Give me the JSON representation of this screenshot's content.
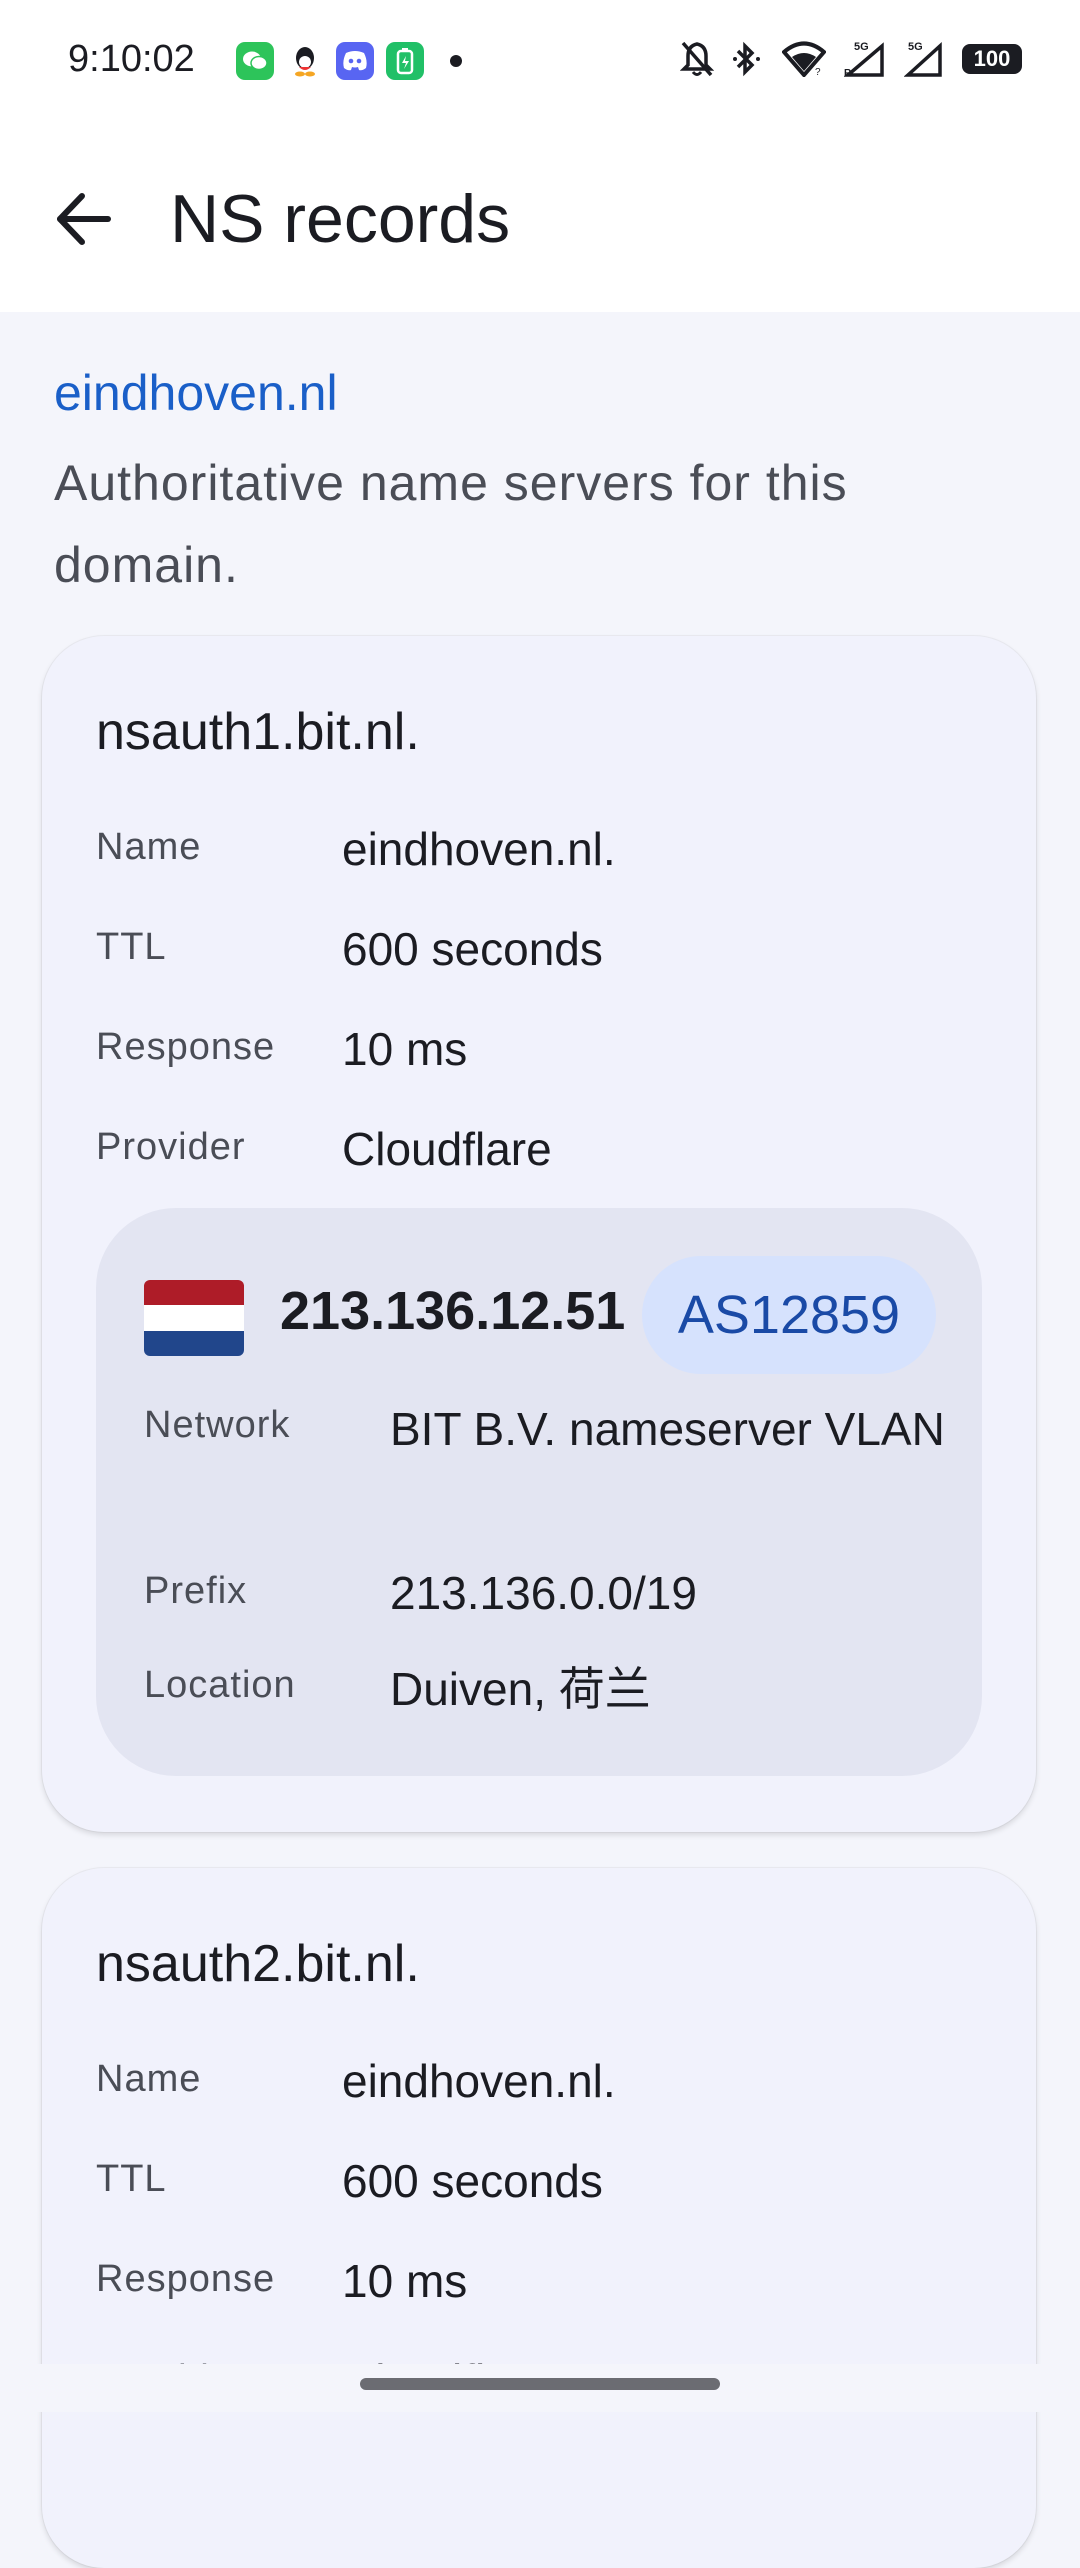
{
  "status_bar": {
    "time": "9:10:02",
    "battery": "100",
    "notification_icons": [
      "wechat-icon",
      "qq-icon",
      "discord-icon",
      "battery-app-icon"
    ],
    "system_icons": [
      "mute-icon",
      "bluetooth-icon",
      "wifi-icon",
      "signal-5g-icon",
      "signal-5g-icon"
    ],
    "signal_labels": [
      "5G",
      "R",
      "5G"
    ]
  },
  "app_bar": {
    "title": "NS records"
  },
  "domain": "eindhoven.nl",
  "description": "Authoritative name servers for this domain.",
  "labels": {
    "name": "Name",
    "ttl": "TTL",
    "response": "Response",
    "provider": "Provider",
    "network": "Network",
    "prefix": "Prefix",
    "location": "Location"
  },
  "records": [
    {
      "host": "nsauth1.bit.nl.",
      "name": "eindhoven.nl.",
      "ttl": "600 seconds",
      "response": "10 ms",
      "provider": "Cloudflare",
      "ip": {
        "address": "213.136.12.51",
        "asn": "AS12859",
        "network": "BIT B.V. nameserver VLAN",
        "prefix": "213.136.0.0/19",
        "location": "Duiven, 荷兰"
      }
    },
    {
      "host": "nsauth2.bit.nl.",
      "name": "eindhoven.nl.",
      "ttl": "600 seconds",
      "response": "10 ms",
      "provider": "Cloudflare"
    }
  ],
  "colors": {
    "accent": "#1a5fc8",
    "chip_bg": "#d6e2fd",
    "card_bg": "#f1f2fc",
    "page_bg": "#f4f5fb"
  }
}
